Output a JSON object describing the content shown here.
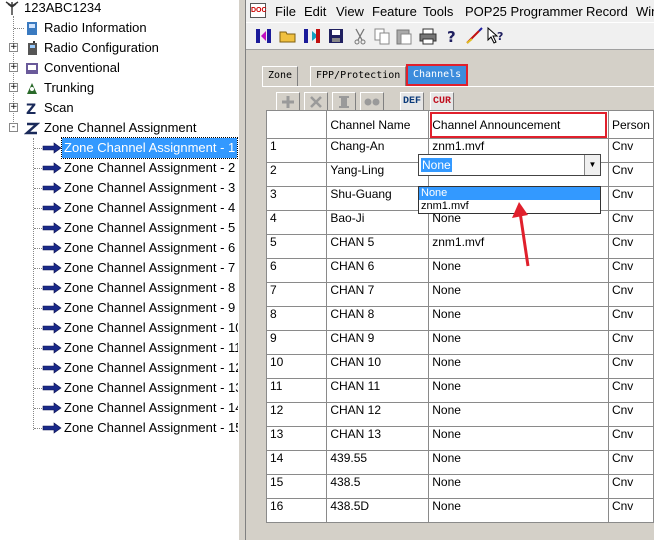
{
  "tree": {
    "root": "123ABC1234",
    "items": [
      {
        "label": "Radio Information",
        "icon": "info-icon",
        "expander": ""
      },
      {
        "label": "Radio Configuration",
        "icon": "radio-config-icon",
        "expander": "+"
      },
      {
        "label": "Conventional",
        "icon": "conventional-icon",
        "expander": "+"
      },
      {
        "label": "Trunking",
        "icon": "trunking-icon",
        "expander": "+"
      },
      {
        "label": "Scan",
        "icon": "scan-icon",
        "expander": "+"
      },
      {
        "label": "Zone Channel Assignment",
        "icon": "zone-icon",
        "expander": "-"
      }
    ],
    "zone_children": [
      "Zone Channel Assignment - 1",
      "Zone Channel Assignment - 2",
      "Zone Channel Assignment - 3",
      "Zone Channel Assignment - 4",
      "Zone Channel Assignment - 5",
      "Zone Channel Assignment - 6",
      "Zone Channel Assignment - 7",
      "Zone Channel Assignment - 8",
      "Zone Channel Assignment - 9",
      "Zone Channel Assignment - 10",
      "Zone Channel Assignment - 11",
      "Zone Channel Assignment - 12",
      "Zone Channel Assignment - 13",
      "Zone Channel Assignment - 14",
      "Zone Channel Assignment - 15"
    ],
    "selected_index": 0
  },
  "menu": {
    "items": [
      "File",
      "Edit",
      "View",
      "Feature",
      "Tools",
      "POP25 Programmer",
      "Record",
      "Win"
    ]
  },
  "tabs": [
    "Zone",
    "FPP/Protection",
    "Channels"
  ],
  "active_tab": "Channels",
  "grid_toolbar": {
    "def": "DEF",
    "cur": "CUR"
  },
  "grid": {
    "headers": [
      "",
      "Channel Name",
      "Channel Announcement",
      "Person"
    ],
    "rows": [
      {
        "n": "1",
        "name": "Chang-An",
        "ann": "znm1.mvf",
        "p": "Cnv"
      },
      {
        "n": "2",
        "name": "Yang-Ling",
        "ann": "",
        "p": "Cnv"
      },
      {
        "n": "3",
        "name": "Shu-Guang",
        "ann": "",
        "p": "Cnv"
      },
      {
        "n": "4",
        "name": "Bao-Ji",
        "ann": "None",
        "p": "Cnv"
      },
      {
        "n": "5",
        "name": "CHAN 5",
        "ann": "znm1.mvf",
        "p": "Cnv"
      },
      {
        "n": "6",
        "name": "CHAN 6",
        "ann": "None",
        "p": "Cnv"
      },
      {
        "n": "7",
        "name": "CHAN 7",
        "ann": "None",
        "p": "Cnv"
      },
      {
        "n": "8",
        "name": "CHAN 8",
        "ann": "None",
        "p": "Cnv"
      },
      {
        "n": "9",
        "name": "CHAN 9",
        "ann": "None",
        "p": "Cnv"
      },
      {
        "n": "10",
        "name": "CHAN 10",
        "ann": "None",
        "p": "Cnv"
      },
      {
        "n": "11",
        "name": "CHAN 11",
        "ann": "None",
        "p": "Cnv"
      },
      {
        "n": "12",
        "name": "CHAN 12",
        "ann": "None",
        "p": "Cnv"
      },
      {
        "n": "13",
        "name": "CHAN 13",
        "ann": "None",
        "p": "Cnv"
      },
      {
        "n": "14",
        "name": "439.55",
        "ann": "None",
        "p": "Cnv"
      },
      {
        "n": "15",
        "name": "438.5",
        "ann": "None",
        "p": "Cnv"
      },
      {
        "n": "16",
        "name": "438.5D",
        "ann": "None",
        "p": "Cnv"
      }
    ]
  },
  "dropdown": {
    "value": "None",
    "options": [
      "None",
      "znm1.mvf"
    ],
    "selected_option": "None"
  },
  "colors": {
    "selection": "#3399ff",
    "highlight_border": "#e0202c",
    "panel": "#d4d0c8"
  }
}
